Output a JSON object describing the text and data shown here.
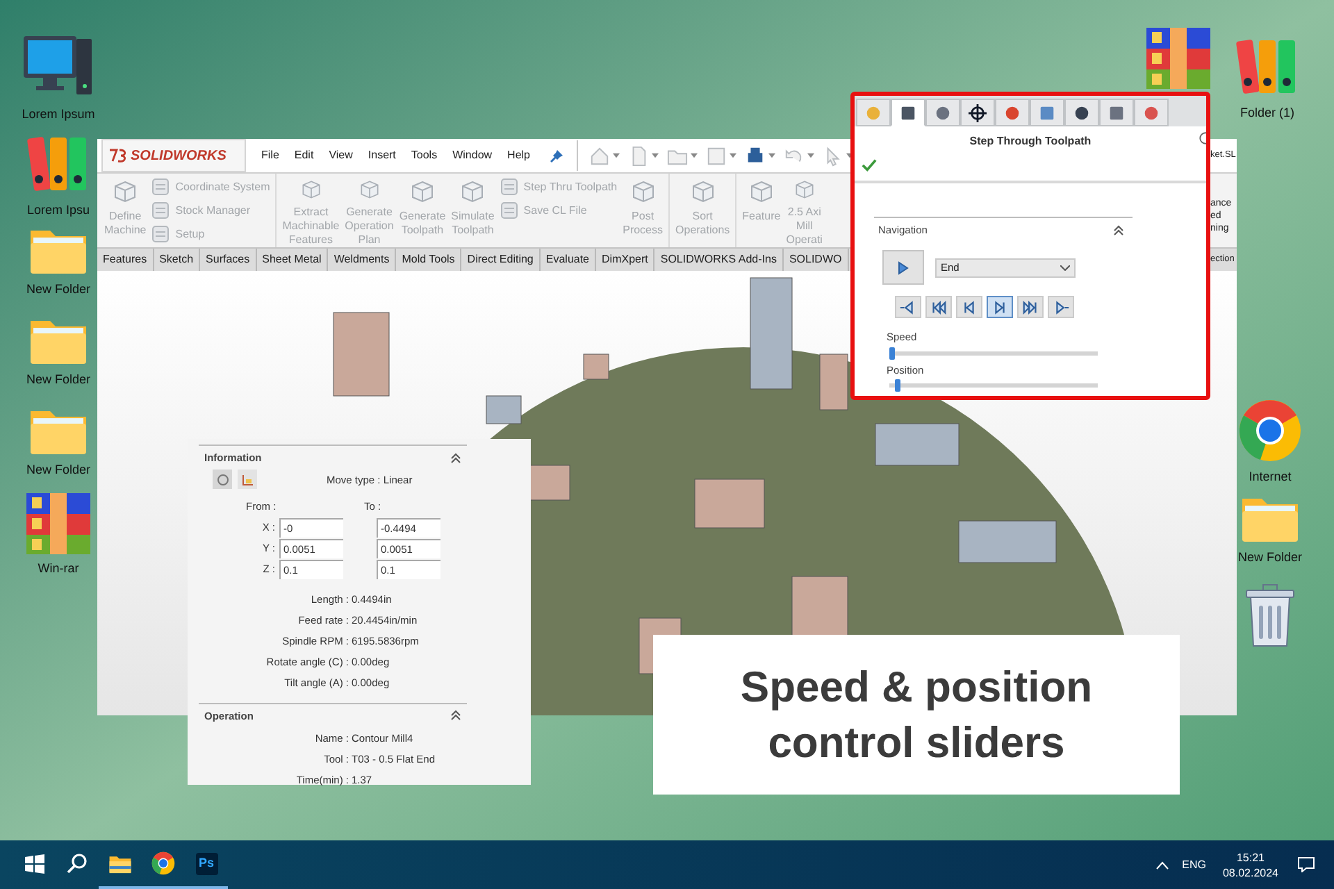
{
  "desktop": {
    "left_icons": [
      {
        "kind": "computer",
        "label": "Lorem Ipsum"
      },
      {
        "kind": "binders",
        "label": "Lorem Ipsu"
      },
      {
        "kind": "folder",
        "label": "New Folder"
      },
      {
        "kind": "folder",
        "label": "New Folder"
      },
      {
        "kind": "folder",
        "label": "New Folder"
      },
      {
        "kind": "archive",
        "label": "Win-rar"
      }
    ],
    "right_icons": [
      {
        "kind": "archive"
      },
      {
        "kind": "binders",
        "label": "Folder (1)"
      },
      {
        "kind": "browser",
        "label": "Internet"
      },
      {
        "kind": "folder",
        "label": "New Folder"
      },
      {
        "kind": "trash"
      }
    ]
  },
  "app_window": {
    "logo": "SOLIDWORKS",
    "menu": [
      "File",
      "Edit",
      "View",
      "Insert",
      "Tools",
      "Window",
      "Help"
    ],
    "document_title": "ket.SL",
    "command_groups": [
      [
        {
          "kind": "large",
          "label": "Define Machine"
        },
        {
          "kind": "stack",
          "items": [
            "Coordinate System",
            "Stock Manager",
            "Setup"
          ]
        }
      ],
      [
        {
          "kind": "large",
          "label": "Extract Machinable Features"
        },
        {
          "kind": "large",
          "label": "Generate Operation Plan"
        },
        {
          "kind": "large",
          "label": "Generate Toolpath"
        },
        {
          "kind": "large",
          "label": "Simulate Toolpath"
        },
        {
          "kind": "stack",
          "items": [
            "Step Thru Toolpath",
            "Save CL File"
          ]
        },
        {
          "kind": "large",
          "label": "Post Process"
        }
      ],
      [
        {
          "kind": "large",
          "label": "Sort Operations"
        }
      ],
      [
        {
          "kind": "large",
          "label": "Feature"
        },
        {
          "kind": "large",
          "label": "2.5 Axi Mill Operati"
        }
      ]
    ],
    "command_cut": "ance ed ning",
    "tabs": [
      "Features",
      "Sketch",
      "Surfaces",
      "Sheet Metal",
      "Weldments",
      "Mold Tools",
      "Direct Editing",
      "Evaluate",
      "DimXpert",
      "SOLIDWORKS Add-Ins",
      "SOLIDWO"
    ],
    "tab_cut": "ection"
  },
  "step_panel": {
    "tabs": [
      {
        "selected": false
      },
      {
        "selected": true
      },
      {
        "selected": false
      },
      {
        "selected": false
      },
      {
        "selected": false
      },
      {
        "selected": false
      },
      {
        "selected": false
      },
      {
        "selected": false
      },
      {
        "selected": false
      }
    ],
    "title": "Step Through Toolpath",
    "navigation": {
      "title": "Navigation",
      "mode": "End",
      "buttons": [
        {
          "pressed": false
        },
        {
          "pressed": false
        },
        {
          "pressed": false
        },
        {
          "pressed": true
        },
        {
          "pressed": false
        },
        {
          "pressed": false
        }
      ],
      "sliders": [
        {
          "label": "Speed",
          "level": 0.0
        },
        {
          "label": "Position",
          "level": 0.03
        }
      ]
    }
  },
  "info_panel": {
    "title": "Information",
    "move_type": "Move type : Linear",
    "from_label": "From :",
    "to_label": "To :",
    "coords": [
      {
        "axis": "X :",
        "from": "-0",
        "to": "-0.4494"
      },
      {
        "axis": "Y :",
        "from": "0.0051",
        "to": "0.0051"
      },
      {
        "axis": "Z :",
        "from": "0.1",
        "to": "0.1"
      }
    ],
    "stats": [
      {
        "label": "Length :",
        "value": "0.4494in"
      },
      {
        "label": "Feed rate :",
        "value": "20.4454in/min"
      },
      {
        "label": "Spindle RPM :",
        "value": "6195.5836rpm"
      },
      {
        "label": "Rotate angle (C) :",
        "value": "0.00deg"
      },
      {
        "label": "Tilt angle (A) :",
        "value": "0.00deg"
      }
    ],
    "operation_title": "Operation",
    "operation": [
      {
        "label": "Name :",
        "value": "Contour Mill4"
      },
      {
        "label": "Tool :",
        "value": "T03 - 0.5 Flat End"
      },
      {
        "label": "Time(min) :",
        "value": "1.37"
      }
    ]
  },
  "caption": [
    "Speed & position",
    "control sliders"
  ],
  "taskbar": {
    "apps": [
      {
        "kind": "start",
        "running": false
      },
      {
        "kind": "search",
        "running": false
      },
      {
        "kind": "explorer",
        "running": true
      },
      {
        "kind": "browser",
        "running": true
      },
      {
        "kind": "photoshop",
        "label": "Ps",
        "running": true
      }
    ],
    "language": "ENG",
    "time": "15:21",
    "date": "08.02.2024"
  }
}
